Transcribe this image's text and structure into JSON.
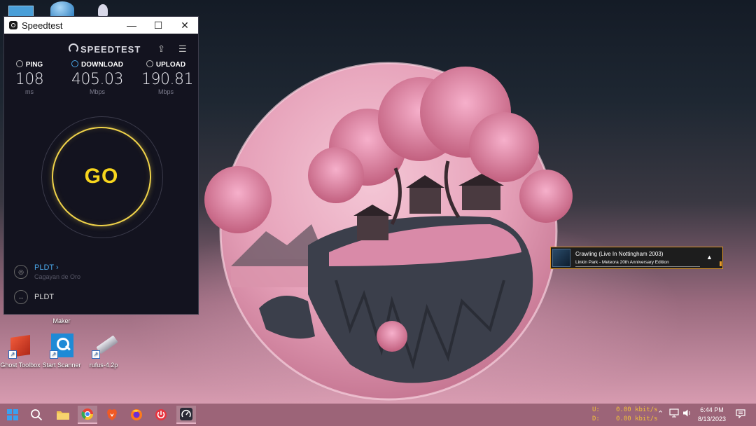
{
  "desktop": {
    "icons": [
      {
        "label": "Ghost Toolbox"
      },
      {
        "label": "Start Scanner"
      },
      {
        "label": "rufus-4.2p"
      }
    ],
    "partial_label": "Maker"
  },
  "speedtest": {
    "window_title": "Speedtest",
    "controls": {
      "minimize": "—",
      "maximize": "☐",
      "close": "✕"
    },
    "brand": "SPEEDTEST",
    "ping": {
      "label": "PING",
      "value": "108",
      "unit": "ms"
    },
    "download": {
      "label": "DOWNLOAD",
      "value": "405.03",
      "unit": "Mbps"
    },
    "upload": {
      "label": "UPLOAD",
      "value": "190.81",
      "unit": "Mbps"
    },
    "go_label": "GO",
    "isp": {
      "name": "PLDT",
      "chevron": "›",
      "location": "Cagayan de Oro"
    },
    "server": {
      "name": "PLDT"
    }
  },
  "media": {
    "title": "Crawling (Live In Nottingham 2003)",
    "artist": "Linkin Park - Meteora 20th Anniversary Edition",
    "expand_glyph": "▲"
  },
  "taskbar": {
    "netspeed": {
      "up_label": "U:",
      "up_value": "0.00 kbit/s",
      "down_label": "D:",
      "down_value": "0.00 kbit/s"
    },
    "clock": {
      "time": "6:44 PM",
      "date": "8/13/2023"
    },
    "colors": {
      "accent": "#f7d51d",
      "taskbar": "#9c6478",
      "netspeed": "#f3c23a"
    }
  }
}
